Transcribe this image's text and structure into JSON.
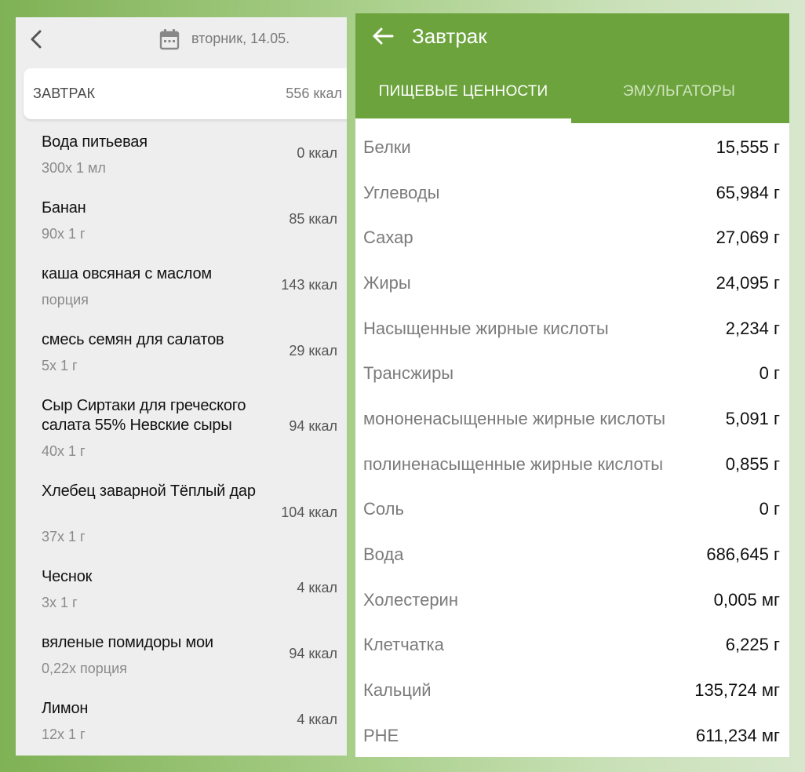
{
  "left": {
    "date": "вторник, 14.05.",
    "meal": {
      "name": "ЗАВТРАК",
      "kcal": "556 ккал"
    },
    "items": [
      {
        "name": "Вода питьевая",
        "portion": "300х 1 мл",
        "kcal": "0 ккал"
      },
      {
        "name": "Банан",
        "portion": "90х 1 г",
        "kcal": "85 ккал"
      },
      {
        "name": "каша овсяная с маслом",
        "portion": "порция",
        "kcal": "143 ккал"
      },
      {
        "name": "смесь семян для салатов",
        "portion": "5х 1 г",
        "kcal": "29 ккал"
      },
      {
        "name": "Сыр Сиртаки для греческого салата 55% Невские сыры",
        "portion": "40х 1 г",
        "kcal": "94 ккал"
      },
      {
        "name": "Хлебец заварной Тёплый дар",
        "portion": "37х 1 г",
        "kcal": "104 ккал"
      },
      {
        "name": "Чеснок",
        "portion": "3х 1 г",
        "kcal": "4 ккал"
      },
      {
        "name": "вяленые помидоры мои",
        "portion": "0,22х порция",
        "kcal": "94 ккал"
      },
      {
        "name": "Лимон",
        "portion": "12х 1 г",
        "kcal": "4 ккал"
      }
    ]
  },
  "right": {
    "title": "Завтрак",
    "tabs": [
      {
        "label": "ПИЩЕВЫЕ ЦЕННОСТИ",
        "active": true
      },
      {
        "label": "ЭМУЛЬГАТОРЫ",
        "active": false
      }
    ],
    "nutrients": [
      {
        "name": "Белки",
        "value": "15,555 г"
      },
      {
        "name": "Углеводы",
        "value": "65,984 г"
      },
      {
        "name": "Сахар",
        "value": "27,069 г"
      },
      {
        "name": "Жиры",
        "value": "24,095 г"
      },
      {
        "name": "Насыщенные жирные кислоты",
        "value": "2,234 г"
      },
      {
        "name": "Трансжиры",
        "value": "0 г"
      },
      {
        "name": "мононенасыщенные жирные кислоты",
        "value": "5,091 г"
      },
      {
        "name": "полиненасыщенные жирные кислоты",
        "value": "0,855 г"
      },
      {
        "name": "Соль",
        "value": "0 г"
      },
      {
        "name": "Вода",
        "value": "686,645 г"
      },
      {
        "name": "Холестерин",
        "value": "0,005 мг"
      },
      {
        "name": "Клетчатка",
        "value": "6,225 г"
      },
      {
        "name": "Кальций",
        "value": "135,724 мг"
      },
      {
        "name": "PHE",
        "value": "611,234 мг"
      }
    ]
  },
  "colors": {
    "accent": "#6ca33d",
    "tab_inactive": "#cfe4bc",
    "panel_bg": "#eeeeee"
  },
  "icons": {
    "back": "chevron-left-icon",
    "calendar": "calendar-icon",
    "appbar_back": "arrow-left-icon"
  }
}
